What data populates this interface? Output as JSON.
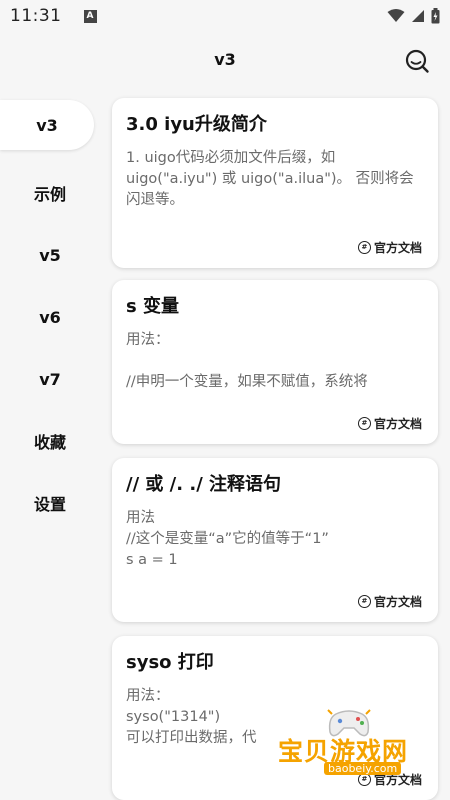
{
  "status": {
    "time": "11:31",
    "notif": "A"
  },
  "header": {
    "title": "v3"
  },
  "sidebar": {
    "items": [
      {
        "label": "v3",
        "active": true
      },
      {
        "label": "示例"
      },
      {
        "label": "v5"
      },
      {
        "label": "v6"
      },
      {
        "label": "v7"
      },
      {
        "label": "收藏"
      },
      {
        "label": "设置"
      }
    ]
  },
  "cards": [
    {
      "title": "3.0 iyu升级简介",
      "body": "1. uigo代码必须加文件后缀，如uigo(\"a.iyu\") 或 uigo(\"a.ilua\")。 否则将会闪退等。",
      "footer": "官方文档"
    },
    {
      "title": "s 变量",
      "body": "用法：\n\n//申明一个变量，如果不赋值，系统将",
      "footer": "官方文档"
    },
    {
      "title": "// 或 /. ./ 注释语句",
      "body": "用法\n//这个是变量“a”它的值等于“1”\ns a = 1",
      "footer": "官方文档"
    },
    {
      "title": "syso 打印",
      "body": "用法：\nsyso(\"1314\")\n可以打印出数据，代",
      "footer": "官方文档"
    }
  ],
  "watermark": {
    "text": "宝贝游戏网",
    "url": "baobeiy.com"
  },
  "colors": {
    "background": "#f6f6f6",
    "card": "#ffffff",
    "watermark": "#f5a300"
  }
}
